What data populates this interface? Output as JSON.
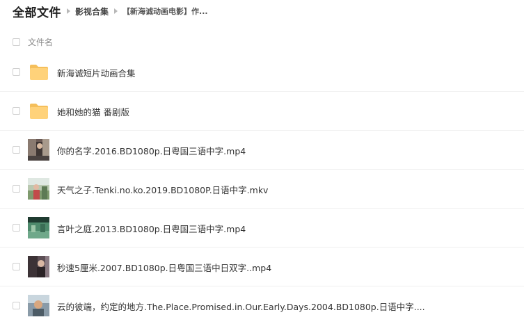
{
  "breadcrumb": {
    "root": "全部文件",
    "middle": "影视合集",
    "current": "【新海诚动画电影】作..."
  },
  "list_header": {
    "name_column": "文件名"
  },
  "files": [
    {
      "name": "新海诚短片动画合集",
      "type": "folder",
      "icon": "folder-icon"
    },
    {
      "name": "她和她的猫 番剧版",
      "type": "folder",
      "icon": "folder-icon"
    },
    {
      "name": "你的名字.2016.BD1080p.日粤国三语中字.mp4",
      "type": "video",
      "icon": "video-thumbnail"
    },
    {
      "name": "天气之子.Tenki.no.ko.2019.BD1080P.日语中字.mkv",
      "type": "video",
      "icon": "video-thumbnail"
    },
    {
      "name": "言叶之庭.2013.BD1080p.日粤国三语中字.mp4",
      "type": "video",
      "icon": "video-thumbnail"
    },
    {
      "name": "秒速5厘米.2007.BD1080p.日粤国三语中日双字..mp4",
      "type": "video",
      "icon": "video-thumbnail"
    },
    {
      "name": "云的彼端，约定的地方.The.Place.Promised.in.Our.Early.Days.2004.BD1080p.日语中字....",
      "type": "video",
      "icon": "video-thumbnail"
    }
  ],
  "colors": {
    "folder": "#FFD27A",
    "folder_back": "#F5BF5B",
    "divider": "#F0F0F0",
    "text": "#333333",
    "muted": "#888888"
  }
}
